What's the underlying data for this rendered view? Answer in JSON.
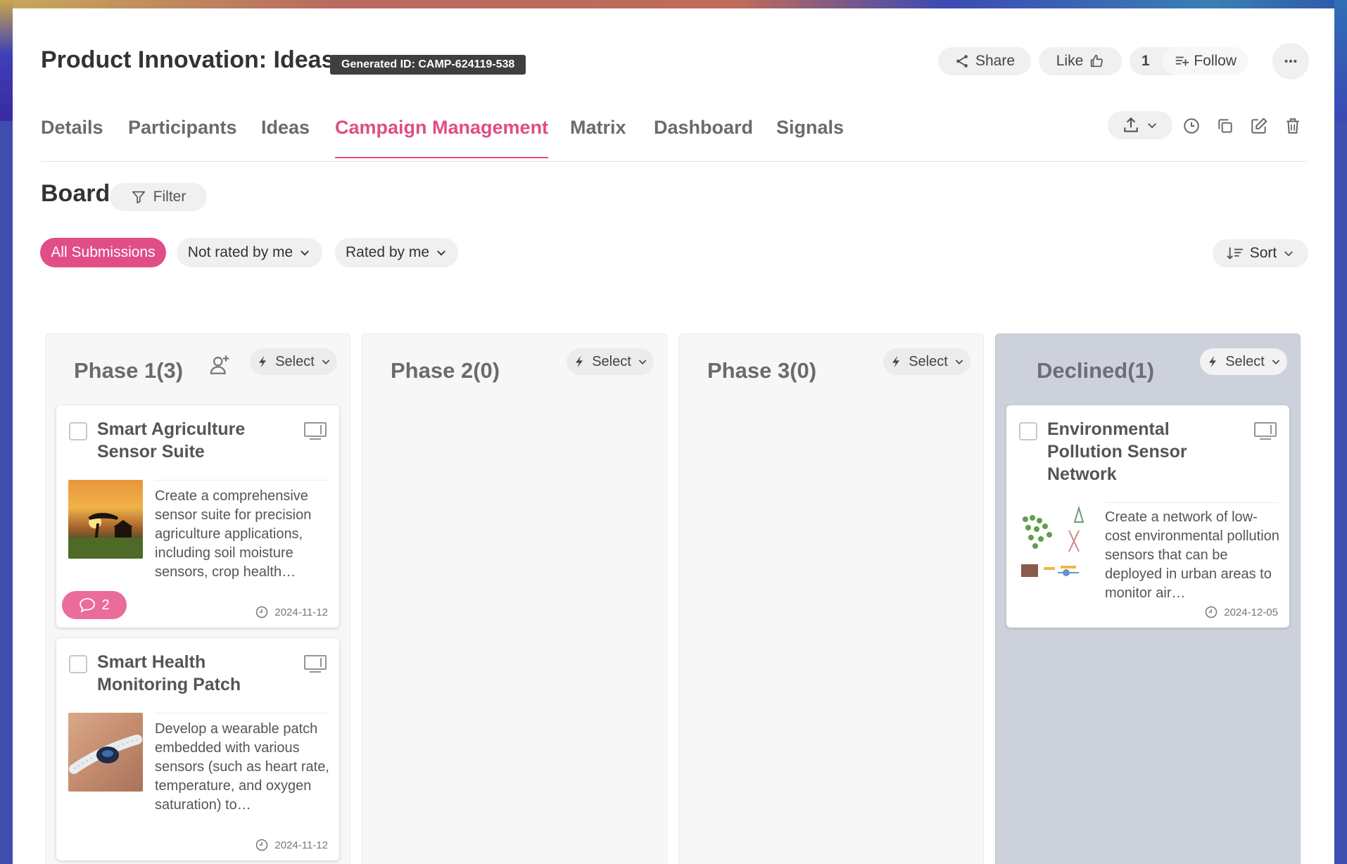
{
  "header": {
    "title": "Product Innovation: Ideas",
    "generated_id": "Generated ID: CAMP-624119-538",
    "share_label": "Share",
    "like_label": "Like",
    "follow_count": "1",
    "follow_label": "Follow",
    "more_icon": "more-horizontal-icon"
  },
  "tabs": [
    {
      "label": "Details"
    },
    {
      "label": "Participants"
    },
    {
      "label": "Ideas"
    },
    {
      "label": "Campaign Management",
      "active": true
    },
    {
      "label": "Matrix"
    },
    {
      "label": "Dashboard"
    },
    {
      "label": "Signals"
    }
  ],
  "board": {
    "title": "Board",
    "filter_label": "Filter",
    "pills": [
      {
        "label": "All Submissions",
        "active": true
      },
      {
        "label": "Not rated by me"
      },
      {
        "label": "Rated by me"
      }
    ],
    "sort_label": "Sort"
  },
  "columns": [
    {
      "title": "Phase 1(3)",
      "select_label": "Select",
      "cards": [
        {
          "title": "Smart Agriculture Sensor Suite",
          "description": "Create a comprehensive sensor suite for precision agriculture applications, including soil moisture sensors, crop health…",
          "comments": "2",
          "date": "2024-11-12"
        },
        {
          "title": "Smart Health Monitoring Patch",
          "description": "Develop a wearable patch embedded with various sensors (such as heart rate, temperature, and oxygen saturation) to…",
          "date": "2024-11-12"
        }
      ]
    },
    {
      "title": "Phase 2(0)",
      "select_label": "Select",
      "cards": []
    },
    {
      "title": "Phase 3(0)",
      "select_label": "Select",
      "cards": []
    },
    {
      "title": "Declined(1)",
      "select_label": "Select",
      "cards": [
        {
          "title": "Environmental Pollution Sensor Network",
          "description": "Create a network of low-cost environmental pollution sensors that can be deployed in urban areas to monitor air…",
          "date": "2024-12-05"
        }
      ]
    }
  ],
  "colors": {
    "accent": "#e04c86",
    "badge_bg": "#3f3f3f",
    "declined_bg": "#cdd1db"
  }
}
